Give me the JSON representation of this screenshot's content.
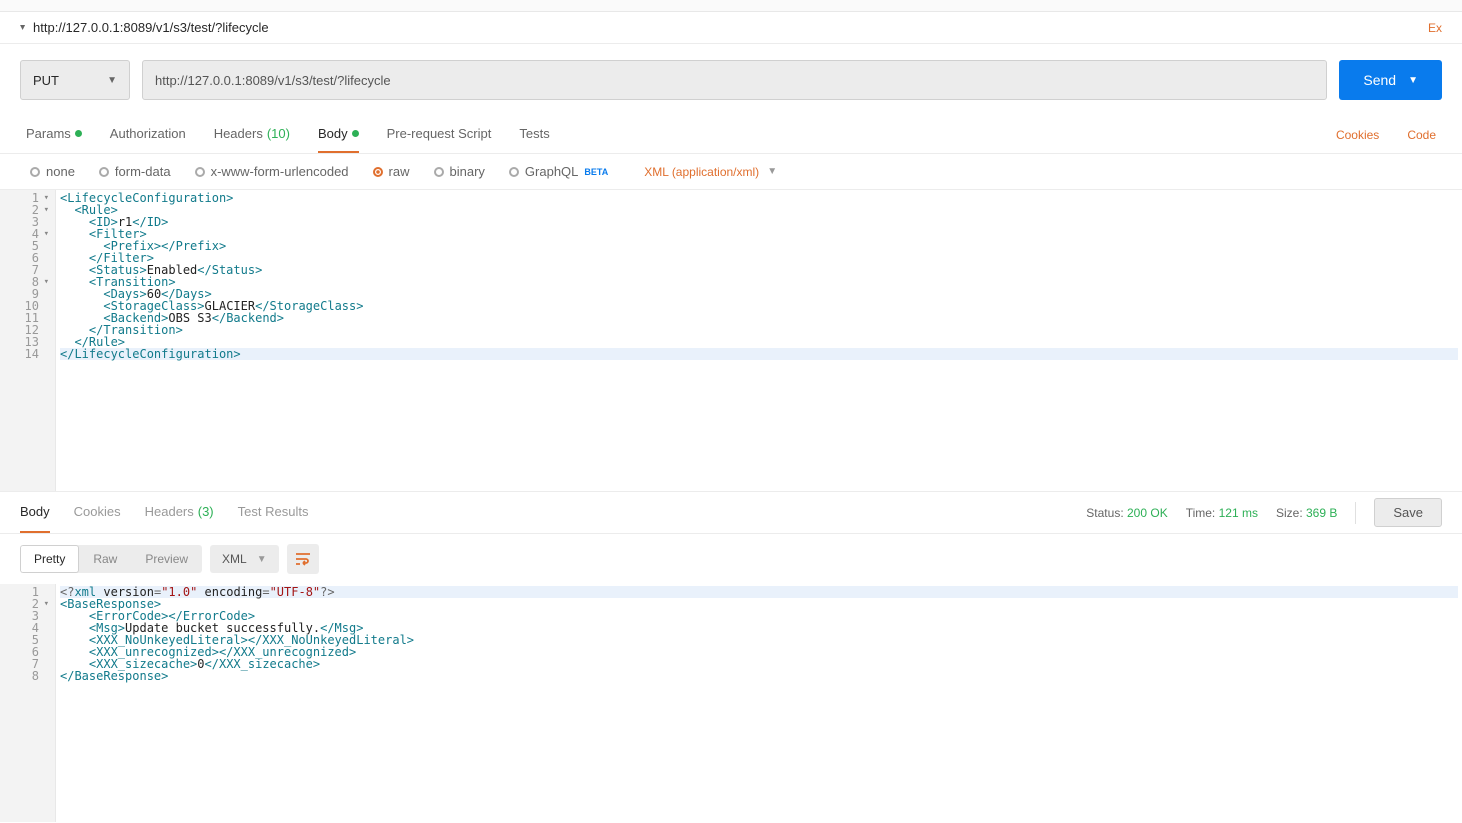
{
  "title_url": "http://127.0.0.1:8089/v1/s3/test/?lifecycle",
  "title_ex": "Ex",
  "method": "PUT",
  "url": "http://127.0.0.1:8089/v1/s3/test/?lifecycle",
  "send_label": "Send",
  "req_tabs": {
    "params": "Params",
    "auth": "Authorization",
    "headers": "Headers",
    "headers_count": "(10)",
    "body": "Body",
    "prereq": "Pre-request Script",
    "tests": "Tests",
    "cookies": "Cookies",
    "code": "Code"
  },
  "body_types": {
    "none": "none",
    "formdata": "form-data",
    "urlenc": "x-www-form-urlencoded",
    "raw": "raw",
    "binary": "binary",
    "graphql": "GraphQL",
    "beta": "BETA",
    "ct": "XML (application/xml)"
  },
  "request_body": {
    "lines": [
      {
        "n": 1,
        "fold": true,
        "html": "<span class='tag-b'>&lt;LifecycleConfiguration&gt;</span>"
      },
      {
        "n": 2,
        "fold": true,
        "html": "  <span class='tag-b'>&lt;Rule&gt;</span>"
      },
      {
        "n": 3,
        "html": "    <span class='tag-b'>&lt;ID&gt;</span><span class='txt'>r1</span><span class='tag-e'>&lt;/ID&gt;</span>"
      },
      {
        "n": 4,
        "fold": true,
        "html": "    <span class='tag-b'>&lt;Filter&gt;</span>"
      },
      {
        "n": 5,
        "html": "      <span class='tag-b'>&lt;Prefix&gt;</span><span class='tag-e'>&lt;/Prefix&gt;</span>"
      },
      {
        "n": 6,
        "html": "    <span class='tag-e'>&lt;/Filter&gt;</span>"
      },
      {
        "n": 7,
        "html": "    <span class='tag-b'>&lt;Status&gt;</span><span class='txt'>Enabled</span><span class='tag-e'>&lt;/Status&gt;</span>"
      },
      {
        "n": 8,
        "fold": true,
        "html": "    <span class='tag-b'>&lt;Transition&gt;</span>"
      },
      {
        "n": 9,
        "html": "      <span class='tag-b'>&lt;Days&gt;</span><span class='txt'>60</span><span class='tag-e'>&lt;/Days&gt;</span>"
      },
      {
        "n": 10,
        "html": "      <span class='tag-b'>&lt;StorageClass&gt;</span><span class='txt'>GLACIER</span><span class='tag-e'>&lt;/StorageClass&gt;</span>"
      },
      {
        "n": 11,
        "html": "      <span class='tag-b'>&lt;Backend&gt;</span><span class='txt'>OBS S3</span><span class='tag-e'>&lt;/Backend&gt;</span>"
      },
      {
        "n": 12,
        "html": "    <span class='tag-e'>&lt;/Transition&gt;</span>"
      },
      {
        "n": 13,
        "html": "  <span class='tag-e'>&lt;/Rule&gt;</span>"
      },
      {
        "n": 14,
        "cursor": true,
        "html": "<span class='tag-e'>&lt;/LifecycleConfiguration&gt;</span>"
      }
    ]
  },
  "resp_tabs": {
    "body": "Body",
    "cookies": "Cookies",
    "headers": "Headers",
    "headers_count": "(3)",
    "tests": "Test Results"
  },
  "resp_meta": {
    "status_l": "Status:",
    "status_v": "200 OK",
    "time_l": "Time:",
    "time_v": "121 ms",
    "size_l": "Size:",
    "size_v": "369 B",
    "save": "Save"
  },
  "resp_view": {
    "pretty": "Pretty",
    "raw": "Raw",
    "preview": "Preview",
    "fmt": "XML"
  },
  "response_body": {
    "lines": [
      {
        "n": 1,
        "cursor": true,
        "html": "<span class='pi'>&lt;?</span><span class='tag-b'>xml</span> <span class='txt'>version</span><span class='pi'>=</span><span class='attr'>\"1.0\"</span> <span class='txt'>encoding</span><span class='pi'>=</span><span class='attr'>\"UTF-8\"</span><span class='pi'>?&gt;</span>"
      },
      {
        "n": 2,
        "fold": true,
        "html": "<span class='tag-b'>&lt;BaseResponse&gt;</span>"
      },
      {
        "n": 3,
        "html": "    <span class='tag-b'>&lt;ErrorCode&gt;</span><span class='tag-e'>&lt;/ErrorCode&gt;</span>"
      },
      {
        "n": 4,
        "html": "    <span class='tag-b'>&lt;Msg&gt;</span><span class='txt'>Update bucket successfully.</span><span class='tag-e'>&lt;/Msg&gt;</span>"
      },
      {
        "n": 5,
        "html": "    <span class='tag-b'>&lt;XXX_NoUnkeyedLiteral&gt;</span><span class='tag-e'>&lt;/XXX_NoUnkeyedLiteral&gt;</span>"
      },
      {
        "n": 6,
        "html": "    <span class='tag-b'>&lt;XXX_unrecognized&gt;</span><span class='tag-e'>&lt;/XXX_unrecognized&gt;</span>"
      },
      {
        "n": 7,
        "html": "    <span class='tag-b'>&lt;XXX_sizecache&gt;</span><span class='txt'>0</span><span class='tag-e'>&lt;/XXX_sizecache&gt;</span>"
      },
      {
        "n": 8,
        "html": "<span class='tag-e'>&lt;/BaseResponse&gt;</span>"
      }
    ]
  }
}
